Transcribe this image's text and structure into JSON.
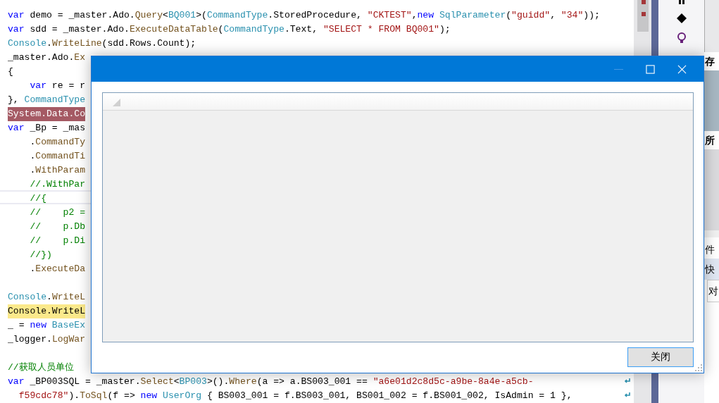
{
  "editor": {
    "lines": [
      {
        "kind": "plain",
        "tokens": [
          {
            "text": "var",
            "kind": "keyword"
          },
          {
            "text": " demo = _master.Ado.",
            "kind": "plain"
          },
          {
            "text": "Query",
            "kind": "method"
          },
          {
            "text": "<",
            "kind": "plain"
          },
          {
            "text": "BQ001",
            "kind": "type"
          },
          {
            "text": ">(",
            "kind": "plain"
          },
          {
            "text": "CommandType",
            "kind": "type"
          },
          {
            "text": ".StoredProcedure, ",
            "kind": "plain"
          },
          {
            "text": "\"CKTEST\"",
            "kind": "string"
          },
          {
            "text": ",",
            "kind": "plain"
          },
          {
            "text": "new",
            "kind": "keyword"
          },
          {
            "text": " SqlParameter",
            "kind": "type"
          },
          {
            "text": "(",
            "kind": "plain"
          },
          {
            "text": "\"guidd\"",
            "kind": "string"
          },
          {
            "text": ", ",
            "kind": "plain"
          },
          {
            "text": "\"34\"",
            "kind": "string"
          },
          {
            "text": "));",
            "kind": "plain"
          }
        ]
      },
      {
        "kind": "plain",
        "tokens": [
          {
            "text": "var",
            "kind": "keyword"
          },
          {
            "text": " sdd = _master.Ado.",
            "kind": "plain"
          },
          {
            "text": "ExecuteDataTable",
            "kind": "method"
          },
          {
            "text": "(",
            "kind": "plain"
          },
          {
            "text": "CommandType",
            "kind": "type"
          },
          {
            "text": ".Text, ",
            "kind": "plain"
          },
          {
            "text": "\"SELECT * FROM BQ001\"",
            "kind": "string"
          },
          {
            "text": ");",
            "kind": "plain"
          }
        ]
      },
      {
        "kind": "plain",
        "tokens": [
          {
            "text": "Console",
            "kind": "type"
          },
          {
            "text": ".",
            "kind": "plain"
          },
          {
            "text": "WriteLine",
            "kind": "method"
          },
          {
            "text": "(sdd.Rows.Count);",
            "kind": "plain"
          }
        ]
      },
      {
        "kind": "plain",
        "tokens": [
          {
            "text": "_master.Ado.",
            "kind": "plain"
          },
          {
            "text": "Ex",
            "kind": "method"
          }
        ]
      },
      {
        "kind": "plain",
        "tokens": [
          {
            "text": "{",
            "kind": "plain"
          }
        ]
      },
      {
        "kind": "plain",
        "tokens": [
          {
            "text": "    var",
            "kind": "keyword"
          },
          {
            "text": " re = r",
            "kind": "plain"
          }
        ]
      },
      {
        "kind": "plain",
        "tokens": [
          {
            "text": "}, ",
            "kind": "plain"
          },
          {
            "text": "CommandType",
            "kind": "type"
          }
        ]
      },
      {
        "kind": "error",
        "tokens": [
          {
            "text": "System.Data.Co",
            "kind": "plain"
          }
        ]
      },
      {
        "kind": "plain",
        "tokens": [
          {
            "text": "var",
            "kind": "keyword"
          },
          {
            "text": " _Bp = _mas",
            "kind": "plain"
          }
        ]
      },
      {
        "kind": "plain",
        "tokens": [
          {
            "text": "    .",
            "kind": "plain"
          },
          {
            "text": "CommandTy",
            "kind": "method"
          }
        ]
      },
      {
        "kind": "plain",
        "tokens": [
          {
            "text": "    .",
            "kind": "plain"
          },
          {
            "text": "CommandTi",
            "kind": "method"
          }
        ]
      },
      {
        "kind": "plain",
        "tokens": [
          {
            "text": "    .",
            "kind": "plain"
          },
          {
            "text": "WithParam",
            "kind": "method"
          }
        ]
      },
      {
        "kind": "plain",
        "tokens": [
          {
            "text": "    //.WithPar",
            "kind": "comment"
          }
        ]
      },
      {
        "kind": "current",
        "tokens": [
          {
            "text": "    //{",
            "kind": "comment"
          }
        ]
      },
      {
        "kind": "plain",
        "tokens": [
          {
            "text": "    //    p2 =",
            "kind": "comment"
          }
        ]
      },
      {
        "kind": "plain",
        "tokens": [
          {
            "text": "    //    p.Db",
            "kind": "comment"
          }
        ]
      },
      {
        "kind": "plain",
        "tokens": [
          {
            "text": "    //    p.Di",
            "kind": "comment"
          }
        ]
      },
      {
        "kind": "plain",
        "tokens": [
          {
            "text": "    //})",
            "kind": "comment"
          }
        ]
      },
      {
        "kind": "plain",
        "tokens": [
          {
            "text": "    .",
            "kind": "plain"
          },
          {
            "text": "ExecuteDa",
            "kind": "method"
          }
        ]
      },
      {
        "kind": "blank"
      },
      {
        "kind": "plain",
        "tokens": [
          {
            "text": "Console",
            "kind": "type"
          },
          {
            "text": ".",
            "kind": "plain"
          },
          {
            "text": "WriteL",
            "kind": "method"
          }
        ]
      },
      {
        "kind": "warning",
        "tokens": [
          {
            "text": "Console.WriteL",
            "kind": "plain"
          }
        ]
      },
      {
        "kind": "plain",
        "tokens": [
          {
            "text": "_ = ",
            "kind": "plain"
          },
          {
            "text": "new",
            "kind": "keyword"
          },
          {
            "text": " BaseEx",
            "kind": "type"
          }
        ]
      },
      {
        "kind": "plain",
        "tokens": [
          {
            "text": "_logger.",
            "kind": "plain"
          },
          {
            "text": "LogWar",
            "kind": "method"
          }
        ]
      },
      {
        "kind": "blank"
      },
      {
        "kind": "plain",
        "tokens": [
          {
            "text": "//获取人员单位",
            "kind": "comment"
          }
        ]
      },
      {
        "kind": "plain",
        "tokens": [
          {
            "text": "var",
            "kind": "keyword"
          },
          {
            "text": " _BP003SQL = _master.",
            "kind": "plain"
          },
          {
            "text": "Select",
            "kind": "method"
          },
          {
            "text": "<",
            "kind": "plain"
          },
          {
            "text": "BP003",
            "kind": "type"
          },
          {
            "text": ">().",
            "kind": "plain"
          },
          {
            "text": "Where",
            "kind": "method"
          },
          {
            "text": "(a => a.BS003_001 == ",
            "kind": "plain"
          },
          {
            "text": "\"a6e01d2c8d5c-a9be-8a4e-a5cb-",
            "kind": "string"
          }
        ]
      },
      {
        "kind": "plain",
        "tokens": [
          {
            "text": "  f59cdc78\"",
            "kind": "string"
          },
          {
            "text": ").",
            "kind": "plain"
          },
          {
            "text": "ToSql",
            "kind": "method"
          },
          {
            "text": "(f => ",
            "kind": "plain"
          },
          {
            "text": "new",
            "kind": "keyword"
          },
          {
            "text": " UserOrg",
            "kind": "type"
          },
          {
            "text": " { BS003_001 = f.BS003_001, BS001_002 = f.BS001_002, IsAdmin = 1 },",
            "kind": "plain"
          }
        ]
      }
    ]
  },
  "tool_panel": {
    "labels": [
      "存",
      "所",
      "件",
      "快",
      "对"
    ]
  },
  "dialog": {
    "minimize": {
      "disabled": true
    },
    "close_button": "关闭"
  }
}
